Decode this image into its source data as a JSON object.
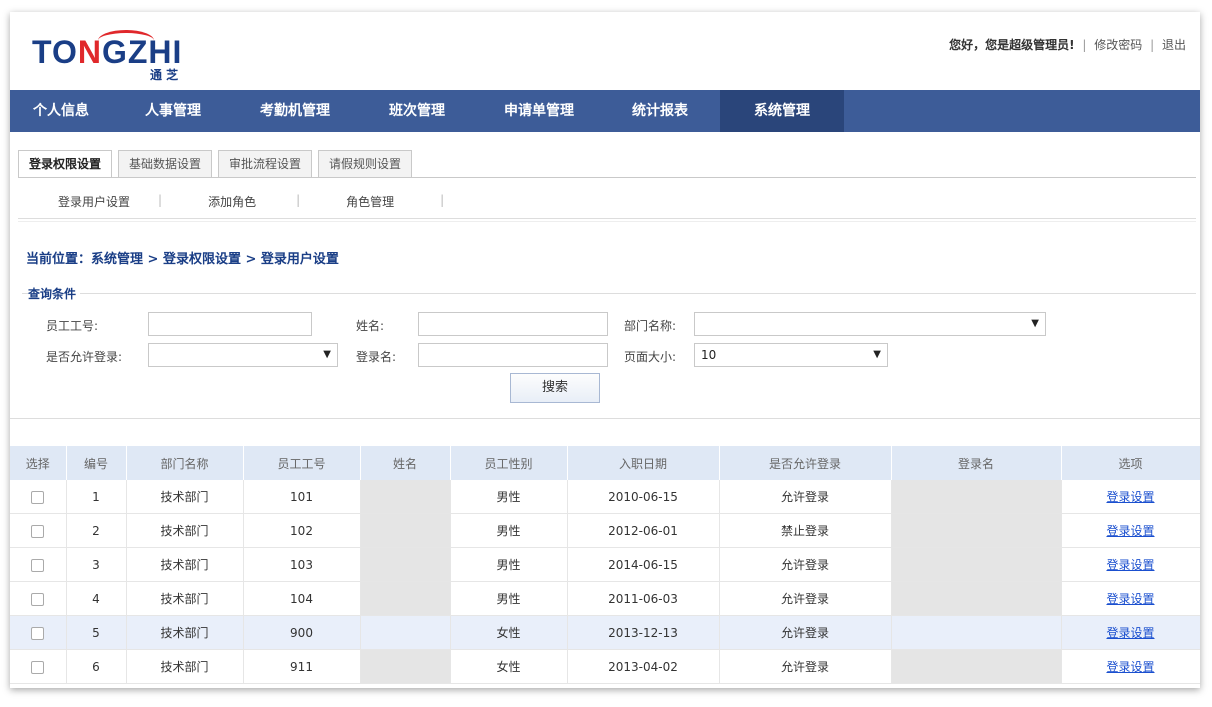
{
  "header": {
    "logo_main_a": "TO",
    "logo_main_b": "N",
    "logo_main_c": "GZHI",
    "logo_sub": "通 芝",
    "greeting": "您好，您是超级管理员!",
    "change_password": "修改密码",
    "logout": "退出"
  },
  "main_nav": {
    "items": [
      "个人信息",
      "人事管理",
      "考勤机管理",
      "班次管理",
      "申请单管理",
      "统计报表",
      "系统管理"
    ],
    "active_index": 6
  },
  "sub_tabs": {
    "items": [
      "登录权限设置",
      "基础数据设置",
      "审批流程设置",
      "请假规则设置"
    ],
    "active_index": 0
  },
  "third_nav": {
    "items": [
      "登录用户设置",
      "添加角色",
      "角色管理"
    ]
  },
  "breadcrumb": "当前位置：系统管理 > 登录权限设置 > 登录用户设置",
  "query": {
    "legend": "查询条件",
    "emp_no_label": "员工工号:",
    "emp_no_value": "",
    "name_label": "姓名:",
    "name_value": "",
    "dept_label": "部门名称:",
    "dept_value": "",
    "allow_login_label": "是否允许登录:",
    "allow_login_value": "",
    "login_name_label": "登录名:",
    "login_name_value": "",
    "page_size_label": "页面大小:",
    "page_size_value": "10",
    "search_button": "搜索"
  },
  "table": {
    "columns": [
      "选择",
      "编号",
      "部门名称",
      "员工工号",
      "姓名",
      "员工性别",
      "入职日期",
      "是否允许登录",
      "登录名",
      "选项"
    ],
    "rows": [
      {
        "id": "1",
        "dept": "技术部门",
        "emp_no": "101",
        "gender": "男性",
        "join_date": "2010-06-15",
        "allow": "允许登录",
        "action": "登录设置"
      },
      {
        "id": "2",
        "dept": "技术部门",
        "emp_no": "102",
        "gender": "男性",
        "join_date": "2012-06-01",
        "allow": "禁止登录",
        "action": "登录设置"
      },
      {
        "id": "3",
        "dept": "技术部门",
        "emp_no": "103",
        "gender": "男性",
        "join_date": "2014-06-15",
        "allow": "允许登录",
        "action": "登录设置"
      },
      {
        "id": "4",
        "dept": "技术部门",
        "emp_no": "104",
        "gender": "男性",
        "join_date": "2011-06-03",
        "allow": "允许登录",
        "action": "登录设置"
      },
      {
        "id": "5",
        "dept": "技术部门",
        "emp_no": "900",
        "gender": "女性",
        "join_date": "2013-12-13",
        "allow": "允许登录",
        "action": "登录设置"
      },
      {
        "id": "6",
        "dept": "技术部门",
        "emp_no": "911",
        "gender": "女性",
        "join_date": "2013-04-02",
        "allow": "允许登录",
        "action": "登录设置"
      }
    ],
    "highlight_row_index": 4
  },
  "colors": {
    "nav_bg": "#3d5c98",
    "nav_active": "#2a457a",
    "brand_blue": "#1a3e86",
    "brand_red": "#e0282b",
    "header_row": "#dfe8f5",
    "link": "#1a4fcf"
  }
}
